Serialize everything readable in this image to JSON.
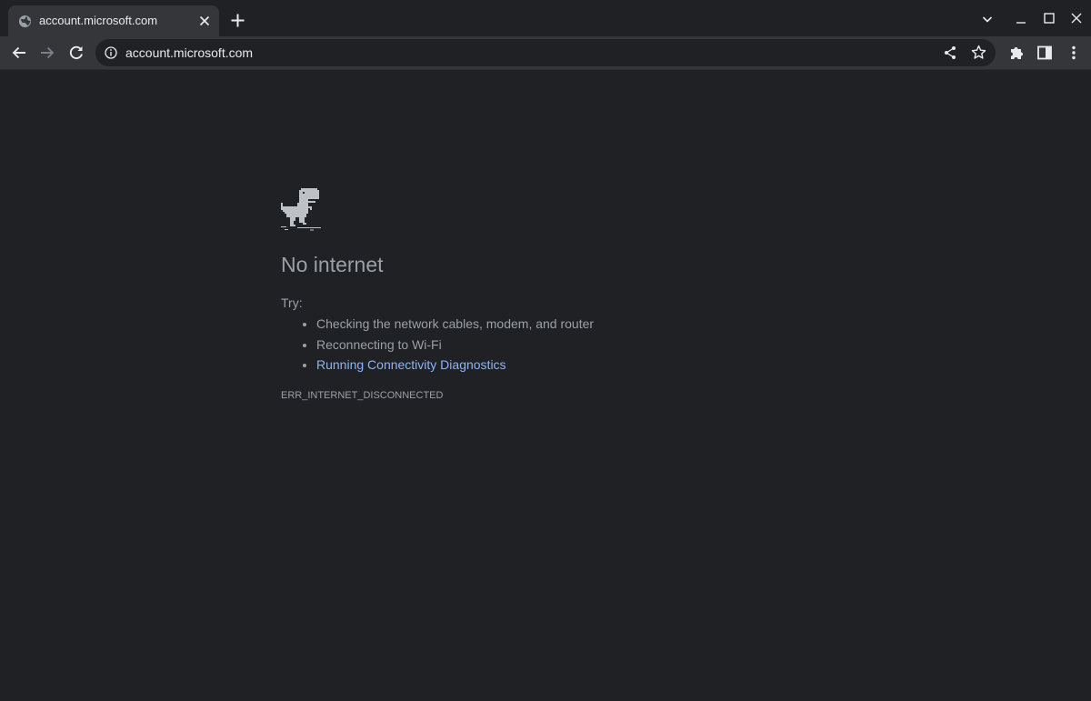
{
  "tab": {
    "title": "account.microsoft.com"
  },
  "omnibox": {
    "url": "account.microsoft.com"
  },
  "page": {
    "heading": "No internet",
    "try_label": "Try:",
    "suggestions": [
      "Checking the network cables, modem, and router",
      "Reconnecting to Wi-Fi",
      "Running Connectivity Diagnostics"
    ],
    "error_code": "ERR_INTERNET_DISCONNECTED"
  },
  "colors": {
    "background": "#202124",
    "toolbar": "#35363a",
    "muted_text": "#9aa0a6",
    "link": "#8ab4f8"
  },
  "icons": {
    "tab_favicon": "globe-icon",
    "tab_close": "close-icon",
    "new_tab": "plus-icon",
    "tab_search": "chevron-down-icon",
    "window": [
      "minimize-icon",
      "maximize-icon",
      "close-icon"
    ],
    "nav": [
      "back-arrow-icon",
      "forward-arrow-icon",
      "reload-icon"
    ],
    "omnibox": [
      "info-icon",
      "share-icon",
      "star-icon"
    ],
    "toolbar_right": [
      "puzzle-icon",
      "side-panel-icon",
      "kebab-menu-icon"
    ],
    "page": "dinosaur-icon"
  }
}
